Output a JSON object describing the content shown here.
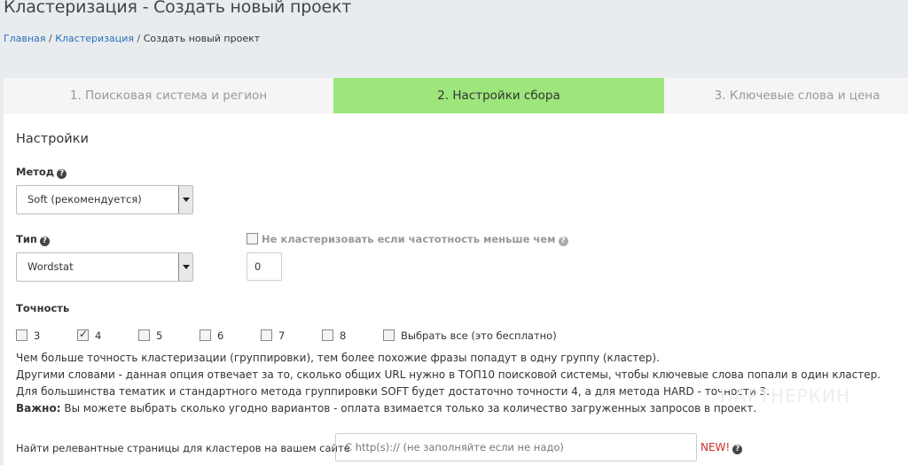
{
  "page": {
    "title": "Кластеризация - Создать новый проект"
  },
  "breadcrumb": {
    "home": "Главная",
    "sep1": " / ",
    "section": "Кластеризация",
    "sep2": " / ",
    "current": "Создать новый проект"
  },
  "tabs": [
    {
      "label": "1. Поисковая система и регион",
      "active": false
    },
    {
      "label": "2. Настройки сбора",
      "active": true
    },
    {
      "label": "3. Ключевые слова и цена",
      "active": false
    }
  ],
  "settings": {
    "title": "Настройки",
    "method": {
      "label": "Метод",
      "value": "Soft (рекомендуется)"
    },
    "type": {
      "label": "Тип",
      "value": "Wordstat"
    },
    "frequency": {
      "label": "Не кластеризовать если частотность меньше чем",
      "value": "0",
      "checked": false
    },
    "accuracy": {
      "label": "Точность",
      "options": [
        {
          "value": "3",
          "checked": false
        },
        {
          "value": "4",
          "checked": true
        },
        {
          "value": "5",
          "checked": false
        },
        {
          "value": "6",
          "checked": false
        },
        {
          "value": "7",
          "checked": false
        },
        {
          "value": "8",
          "checked": false
        }
      ],
      "select_all": "Выбрать все (это бесплатно)"
    },
    "info": {
      "line1": "Чем больше точность кластеризации (группировки), тем более похожие фразы попадут в одну группу (кластер).",
      "line2": "Другими словами - данная опция отвечает за то, сколько общих URL нужно в ТОП10 поисковой системы, чтобы ключевые слова попали в один кластер.",
      "line3": "Для большинства тематик и стандартного метода группировки SOFT будет достаточно точности 4, а для метода HARD - точности 3.",
      "important_label": "Важно:",
      "important_text": " Вы можете выбрать сколько угодно вариантов - оплата взимается только за количество загруженных запросов в проект."
    },
    "find": {
      "label": "Найти релевантные страницы для кластеров на вашем сайте",
      "placeholder": "С http(s):// (не заполняйте если не надо)",
      "badge": "NEW!"
    }
  },
  "watermark": "ПАРТНЕРКИН",
  "icons": {
    "help": "question-circle-icon",
    "checkmark": "check-icon",
    "dropdown": "chevron-down-icon"
  },
  "colors": {
    "active_tab": "#9de67b",
    "link": "#2a6ebb",
    "new_badge": "#c9302c"
  }
}
